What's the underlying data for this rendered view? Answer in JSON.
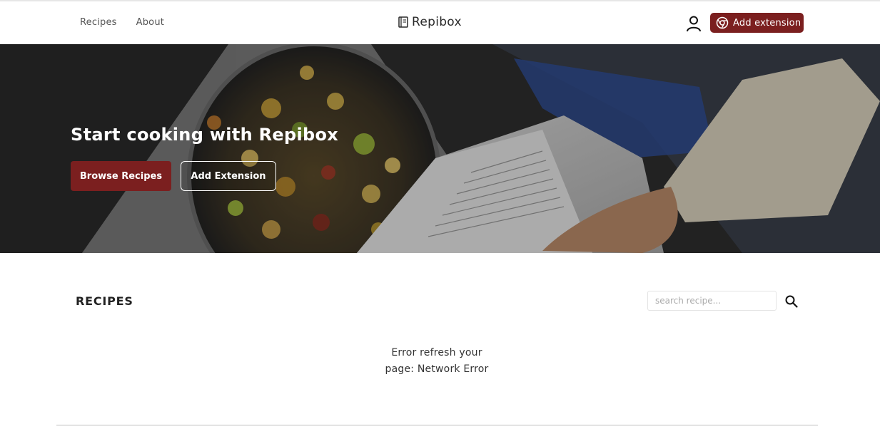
{
  "header": {
    "nav": [
      {
        "label": "Recipes"
      },
      {
        "label": "About"
      }
    ],
    "brand": "Repibox",
    "extension_button": "Add extension",
    "accent_color": "#7b1f1f"
  },
  "hero": {
    "title": "Start cooking with Repibox",
    "browse_button": "Browse Recipes",
    "add_extension_button": "Add Extension"
  },
  "recipes": {
    "title": "RECIPES",
    "search_placeholder": "search recipe...",
    "error_line1": "Error refresh your",
    "error_line2": "page: Network Error"
  },
  "icons": {
    "brand": "book-icon",
    "user": "user-icon",
    "extension": "chrome-icon",
    "search": "search-icon"
  }
}
